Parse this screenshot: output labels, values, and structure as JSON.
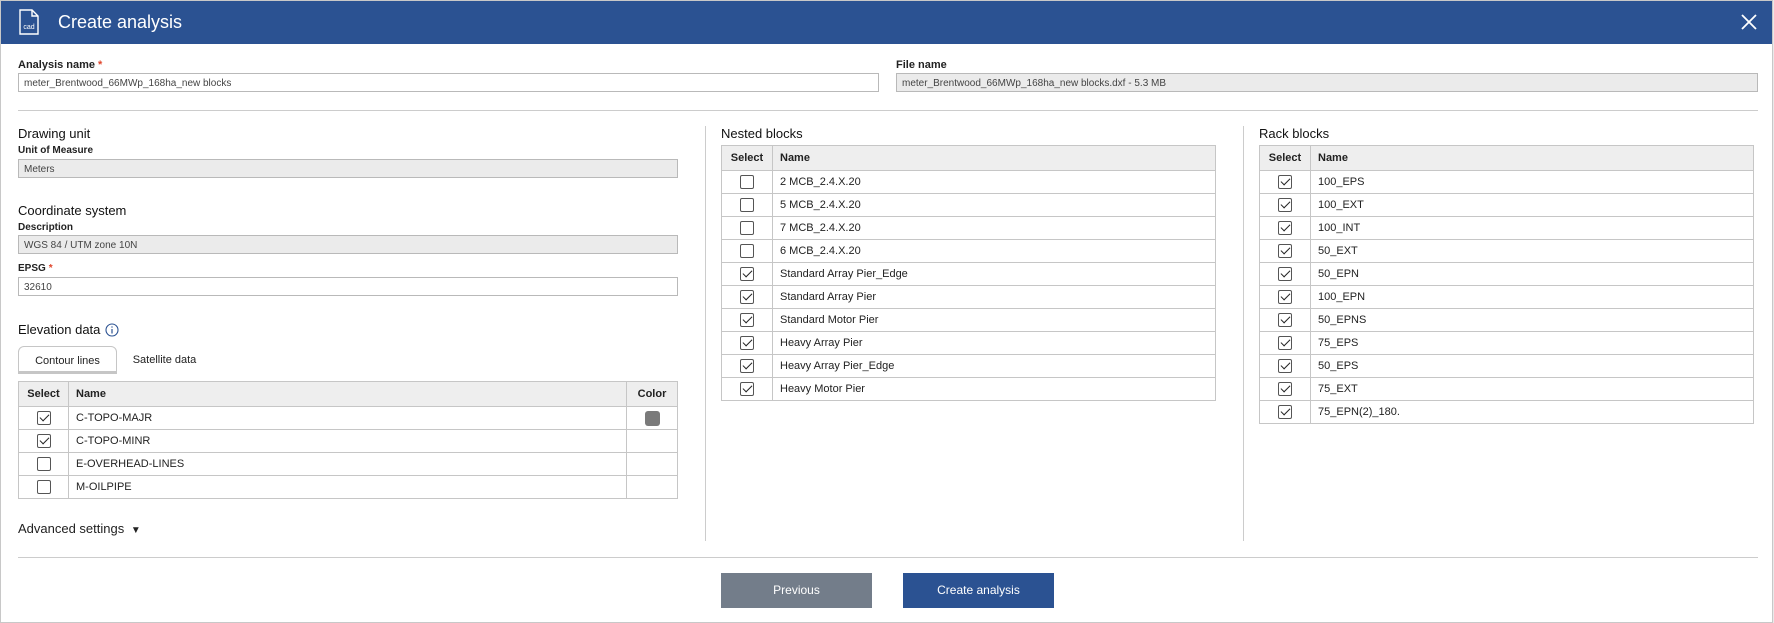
{
  "window": {
    "title": "Create analysis"
  },
  "analysis": {
    "label": "Analysis name",
    "required": "*",
    "value": "meter_Brentwood_66MWp_168ha_new blocks"
  },
  "file": {
    "label": "File name",
    "value": "meter_Brentwood_66MWp_168ha_new blocks.dxf - 5.3 MB"
  },
  "drawing_unit": {
    "heading": "Drawing unit",
    "label": "Unit of Measure",
    "value": "Meters"
  },
  "coordinate": {
    "heading": "Coordinate system",
    "desc_label": "Description",
    "desc_value": "WGS 84 / UTM zone 10N",
    "epsg_label": "EPSG",
    "epsg_required": "*",
    "epsg_value": "32610"
  },
  "elevation": {
    "heading": "Elevation data",
    "tabs": [
      "Contour lines",
      "Satellite data"
    ],
    "columns": [
      "Select",
      "Name",
      "Color"
    ],
    "rows": [
      {
        "name": "C-TOPO-MAJR",
        "checked": true,
        "color": "#7a7a7a"
      },
      {
        "name": "C-TOPO-MINR",
        "checked": true,
        "color": ""
      },
      {
        "name": "E-OVERHEAD-LINES",
        "checked": false,
        "color": ""
      },
      {
        "name": "M-OILPIPE",
        "checked": false,
        "color": ""
      }
    ]
  },
  "advanced": {
    "label": "Advanced settings"
  },
  "nested": {
    "heading": "Nested blocks",
    "columns": [
      "Select",
      "Name"
    ],
    "rows": [
      {
        "name": "2 MCB_2.4.X.20",
        "checked": false
      },
      {
        "name": "5 MCB_2.4.X.20",
        "checked": false
      },
      {
        "name": "7 MCB_2.4.X.20",
        "checked": false
      },
      {
        "name": "6 MCB_2.4.X.20",
        "checked": false
      },
      {
        "name": "Standard Array Pier_Edge",
        "checked": true
      },
      {
        "name": "Standard Array Pier",
        "checked": true
      },
      {
        "name": "Standard Motor Pier",
        "checked": true
      },
      {
        "name": "Heavy Array Pier",
        "checked": true
      },
      {
        "name": "Heavy Array Pier_Edge",
        "checked": true
      },
      {
        "name": "Heavy Motor Pier",
        "checked": true
      }
    ]
  },
  "rack": {
    "heading": "Rack blocks",
    "columns": [
      "Select",
      "Name"
    ],
    "rows": [
      {
        "name": "100_EPS",
        "checked": true
      },
      {
        "name": "100_EXT",
        "checked": true
      },
      {
        "name": "100_INT",
        "checked": true
      },
      {
        "name": "50_EXT",
        "checked": true
      },
      {
        "name": "50_EPN",
        "checked": true
      },
      {
        "name": "100_EPN",
        "checked": true
      },
      {
        "name": "50_EPNS",
        "checked": true
      },
      {
        "name": "75_EPS",
        "checked": true
      },
      {
        "name": "50_EPS",
        "checked": true
      },
      {
        "name": "75_EXT",
        "checked": true
      },
      {
        "name": "75_EPN(2)_180.",
        "checked": true
      }
    ]
  },
  "buttons": {
    "previous": "Previous",
    "create": "Create analysis"
  },
  "colors": {
    "primary": "#2b5292",
    "secondary": "#737d8a"
  },
  "icons": {
    "app": "cad-file-icon",
    "close": "close-icon",
    "info": "info-icon",
    "advanced": "caret-down-icon"
  }
}
